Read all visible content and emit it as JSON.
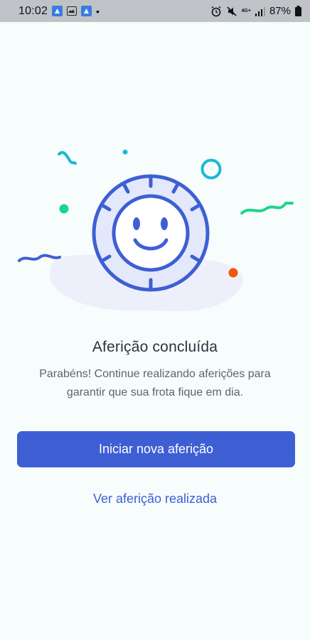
{
  "status_bar": {
    "time": "10:02",
    "dot": "•",
    "network": "4G+",
    "battery_percent": "87%",
    "icons": [
      "app-notification-icon",
      "image-icon",
      "app-notification-icon",
      "alarm-icon",
      "mute-icon",
      "signal-icon",
      "battery-icon"
    ]
  },
  "illustration": {
    "description_icon": "smiling-tire-icon",
    "colors": {
      "primary": "#3E5FD4",
      "tire_fill": "#E3E9FB",
      "blob": "#EEF0FA",
      "teal": "#1DB8D6",
      "green": "#1DD58A",
      "orange": "#F2560C"
    }
  },
  "content": {
    "title": "Aferição concluída",
    "subtitle": "Parabéns! Continue realizando aferições para garantir que sua frota fique em dia."
  },
  "actions": {
    "primary_label": "Iniciar nova aferição",
    "secondary_label": "Ver aferição realizada"
  },
  "theme": {
    "accent": "#3E5FD4",
    "background": "#F7FCFC"
  }
}
